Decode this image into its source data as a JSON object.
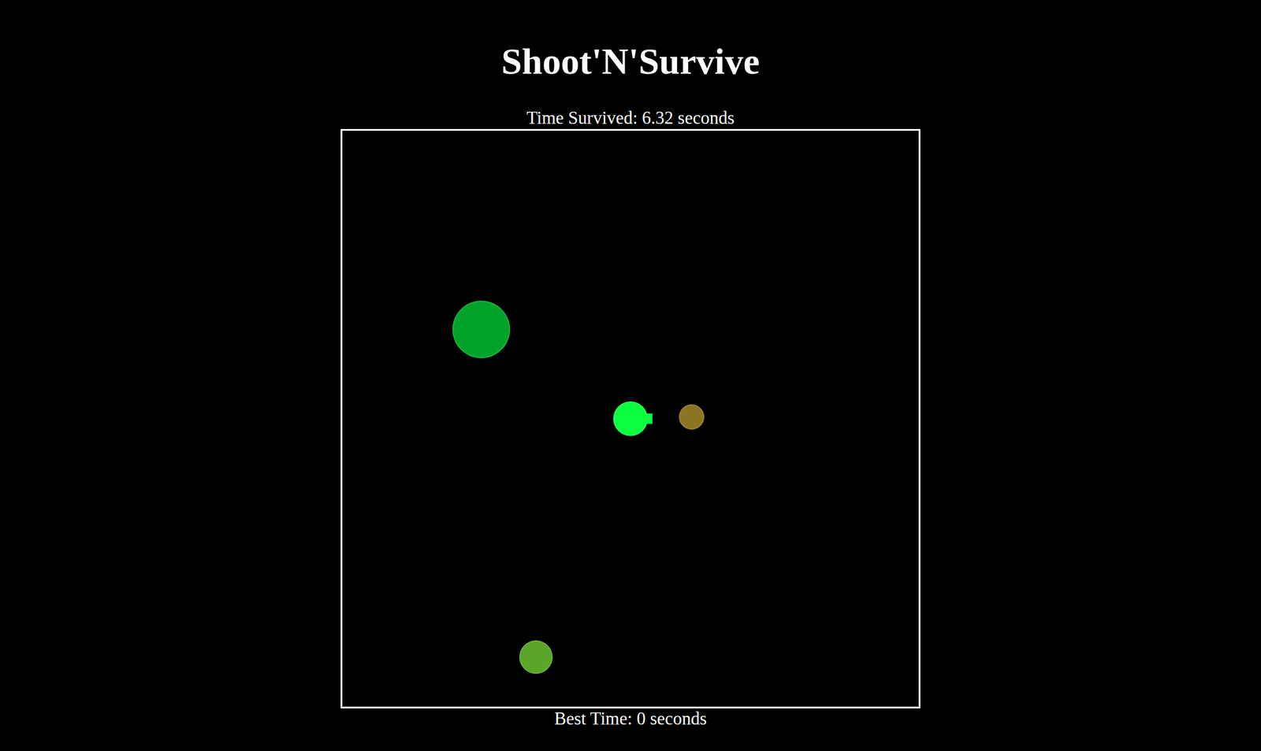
{
  "title": "Shoot'N'Survive",
  "timer": {
    "label": "Time Survived: 6.32 seconds"
  },
  "best": {
    "label": "Best Time: 0 seconds"
  },
  "entities": [
    {
      "kind": "enemy",
      "color": "#00a32a"
    },
    {
      "kind": "player",
      "color": "#0bff3f"
    },
    {
      "kind": "enemy",
      "color": "#8c7422"
    },
    {
      "kind": "enemy",
      "color": "#5aa628"
    }
  ]
}
